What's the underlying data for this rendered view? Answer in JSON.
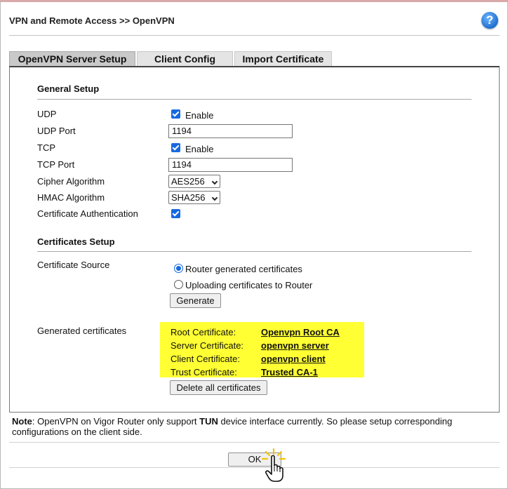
{
  "header": {
    "title": "VPN and Remote Access >> OpenVPN",
    "help_icon": "?"
  },
  "tabs": [
    {
      "label": "OpenVPN Server Setup",
      "active": true
    },
    {
      "label": "Client Config",
      "active": false
    },
    {
      "label": "Import Certificate",
      "active": false
    }
  ],
  "general": {
    "title": "General Setup",
    "udp_label": "UDP",
    "udp_enable_label": "Enable",
    "udp_enabled": true,
    "udp_port_label": "UDP Port",
    "udp_port": "1194",
    "tcp_label": "TCP",
    "tcp_enable_label": "Enable",
    "tcp_enabled": true,
    "tcp_port_label": "TCP Port",
    "tcp_port": "1194",
    "cipher_label": "Cipher Algorithm",
    "cipher_value": "AES256",
    "hmac_label": "HMAC Algorithm",
    "hmac_value": "SHA256",
    "cert_auth_label": "Certificate Authentication",
    "cert_auth_enabled": true
  },
  "certificates": {
    "title": "Certificates Setup",
    "source_label": "Certificate Source",
    "options": [
      "Router generated certificates",
      "Uploading certificates to Router"
    ],
    "selected_index": 0,
    "generate_button": "Generate",
    "generated_label": "Generated certificates",
    "list": [
      {
        "name": "Root Certificate:",
        "value": "Openvpn Root CA"
      },
      {
        "name": "Server Certificate:",
        "value": "openvpn server"
      },
      {
        "name": "Client Certificate:",
        "value": "openvpn client"
      },
      {
        "name": "Trust Certificate:",
        "value": "Trusted CA-1"
      }
    ],
    "delete_button": "Delete all certificates",
    "highlight_color": "#ffff33"
  },
  "note": {
    "prefix": "Note",
    "text1": ": OpenVPN on Vigor Router only support ",
    "bold": "TUN",
    "text2": " device interface currently. So please setup corresponding configurations on the client side."
  },
  "ok_button": "OK",
  "colors": {
    "accent": "#1769e0",
    "tab_active": "#c9c9c9",
    "tab_inactive": "#e4e4e4"
  }
}
